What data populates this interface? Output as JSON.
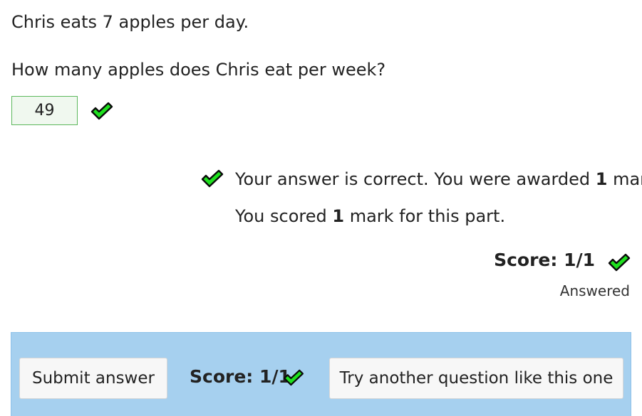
{
  "question": {
    "prompt": "Chris eats 7 apples per day.",
    "sub_prompt": "How many apples does Chris eat per week?",
    "answer_value": "49"
  },
  "feedback": {
    "line1_prefix": "Your answer is correct. You were awarded ",
    "line1_marks": "1",
    "line1_suffix": " mark.",
    "line2_prefix": "You scored ",
    "line2_marks": "1",
    "line2_suffix": " mark for this part."
  },
  "part_score": {
    "label": "Score: 1/1",
    "status": "Answered"
  },
  "bottom_bar": {
    "submit_label": "Submit answer",
    "score_label": "Score: 1/1",
    "try_another_label": "Try another question like this one"
  },
  "icons": {
    "tick": "check-icon"
  },
  "colors": {
    "tick_fill": "#1fe01f",
    "tick_stroke": "#0a0a0a",
    "answer_border": "#5cb85c",
    "answer_bg": "#f0f8ef",
    "bottom_bar_bg": "#a6d0ef"
  }
}
